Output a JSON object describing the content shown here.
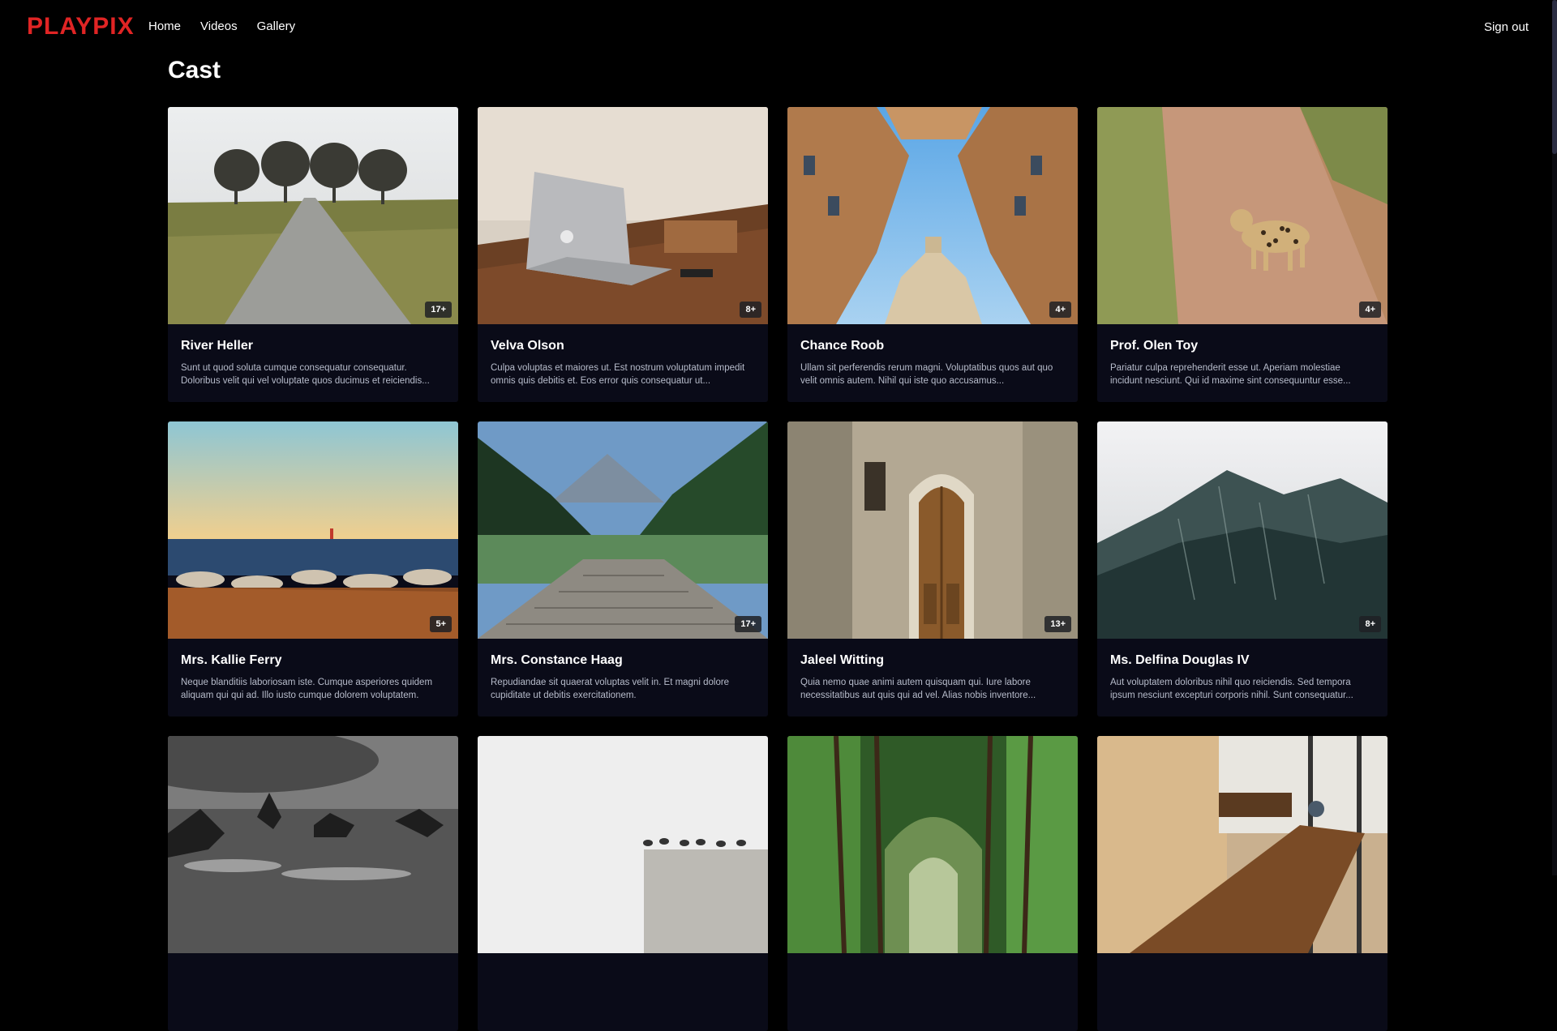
{
  "header": {
    "logo": "PLAYPIX",
    "nav": [
      "Home",
      "Videos",
      "Gallery"
    ],
    "signout": "Sign out"
  },
  "page": {
    "title": "Cast"
  },
  "colors": {
    "brand": "#e02424",
    "card_bg": "#0a0b18",
    "page_bg": "#000000"
  },
  "cards": [
    {
      "name": "River Heller",
      "badge": "17+",
      "desc": "Sunt ut quod soluta cumque consequatur consequatur. Doloribus velit qui vel voluptate quos ducimus et reiciendis..."
    },
    {
      "name": "Velva Olson",
      "badge": "8+",
      "desc": "Culpa voluptas et maiores ut. Est nostrum voluptatum impedit omnis quis debitis et. Eos error quis consequatur ut..."
    },
    {
      "name": "Chance Roob",
      "badge": "4+",
      "desc": "Ullam sit perferendis rerum magni. Voluptatibus quos aut quo velit omnis autem. Nihil qui iste quo accusamus..."
    },
    {
      "name": "Prof. Olen Toy",
      "badge": "4+",
      "desc": "Pariatur culpa reprehenderit esse ut. Aperiam molestiae incidunt nesciunt. Qui id maxime sint consequuntur esse..."
    },
    {
      "name": "Mrs. Kallie Ferry",
      "badge": "5+",
      "desc": "Neque blanditiis laboriosam iste. Cumque asperiores quidem aliquam qui qui ad. Illo iusto cumque dolorem voluptatem."
    },
    {
      "name": "Mrs. Constance Haag",
      "badge": "17+",
      "desc": "Repudiandae sit quaerat voluptas velit in. Et magni dolore cupiditate ut debitis exercitationem."
    },
    {
      "name": "Jaleel Witting",
      "badge": "13+",
      "desc": "Quia nemo quae animi autem quisquam qui. Iure labore necessitatibus aut quis qui ad vel. Alias nobis inventore..."
    },
    {
      "name": "Ms. Delfina Douglas IV",
      "badge": "8+",
      "desc": "Aut voluptatem doloribus nihil quo reiciendis. Sed tempora ipsum nesciunt excepturi corporis nihil. Sunt consequatur..."
    },
    {
      "name": "",
      "badge": "",
      "desc": ""
    },
    {
      "name": "",
      "badge": "",
      "desc": ""
    },
    {
      "name": "",
      "badge": "",
      "desc": ""
    },
    {
      "name": "",
      "badge": "",
      "desc": ""
    }
  ]
}
